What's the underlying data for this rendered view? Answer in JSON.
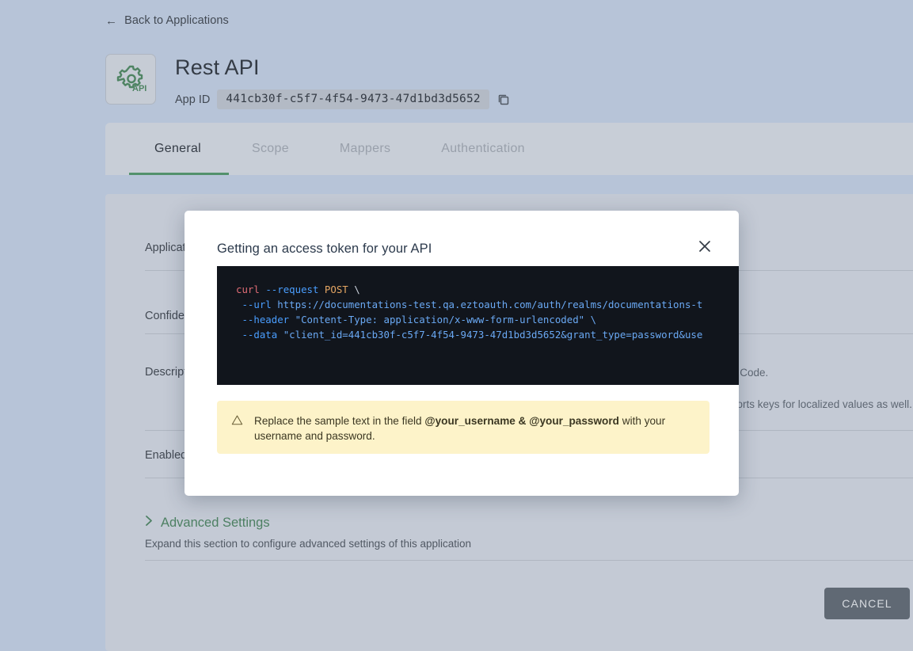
{
  "page": {
    "back_link": "Back to Applications",
    "back_arrow_glyph": "←",
    "app_title": "Rest API",
    "app_icon_label": "API",
    "appid_label": "App ID",
    "appid_value": "441cb30f-c5f7-4f54-9473-47d1bd3d5652"
  },
  "tabs": [
    {
      "label": "General",
      "active": true
    },
    {
      "label": "Scope",
      "active": false
    },
    {
      "label": "Mappers",
      "active": false
    },
    {
      "label": "Authentication",
      "active": false
    }
  ],
  "form": {
    "labels": [
      "Application",
      "Confidential",
      "Description",
      "Enabled"
    ],
    "hints": [
      "h Code.",
      "ports keys for localized values as well."
    ]
  },
  "advanced": {
    "chevron_glyph": "›",
    "title": "Advanced Settings",
    "subtitle": "Expand this section to configure advanced settings of this application"
  },
  "footer": {
    "cancel_label": "CANCEL"
  },
  "modal": {
    "title": "Getting an access token for your API",
    "close_glyph": "✕",
    "code": {
      "line1": {
        "cmd": "curl ",
        "flag": "--request ",
        "verb": "POST",
        "tail": " \\"
      },
      "line2": {
        "flag": " --url ",
        "value": "https://documentations-test.qa.eztoauth.com/auth/realms/documentations-t"
      },
      "line3": {
        "flag": " --header ",
        "value": "\"Content-Type: application/x-www-form-urlencoded\" \\"
      },
      "line4": {
        "flag": " --data ",
        "value": "\"client_id=441cb30f-c5f7-4f54-9473-47d1bd3d5652&grant_type=password&use"
      }
    },
    "warning": {
      "icon_glyph": "⚠",
      "prefix": "Replace the sample text in the field ",
      "bold": "@your_username & @your_password",
      "suffix": " with your username and password."
    }
  },
  "colors": {
    "accent_green": "#2e9e5b",
    "page_bg": "#b7c4d8",
    "code_bg": "#11151c",
    "warning_bg": "#fdf3c9"
  }
}
